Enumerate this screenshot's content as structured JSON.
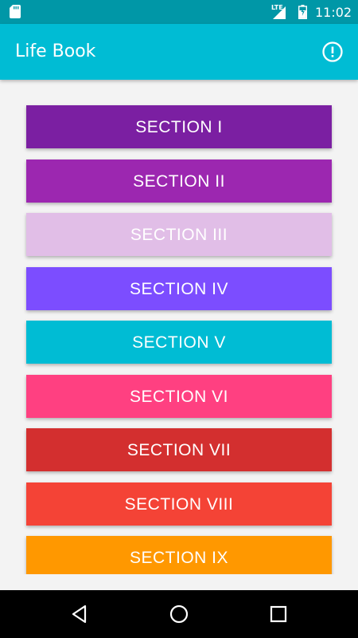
{
  "status_bar": {
    "time": "11:02",
    "network": "LTE",
    "icons": [
      "sd-card-icon",
      "signal-icon",
      "battery-icon"
    ]
  },
  "app_bar": {
    "title": "Life Book",
    "action_icon": "info-icon"
  },
  "sections": [
    {
      "label": "SECTION I",
      "color": "#7b1fa2"
    },
    {
      "label": "SECTION II",
      "color": "#9c27b0"
    },
    {
      "label": "SECTION III",
      "color": "#e1bee7"
    },
    {
      "label": "SECTION IV",
      "color": "#7c4dff"
    },
    {
      "label": "SECTION V",
      "color": "#00bcd4"
    },
    {
      "label": "SECTION VI",
      "color": "#ff4081"
    },
    {
      "label": "SECTION VII",
      "color": "#d32f2f"
    },
    {
      "label": "SECTION VIII",
      "color": "#f44336"
    },
    {
      "label": "SECTION IX",
      "color": "#ff9800"
    }
  ],
  "colors": {
    "status_bar": "#0097a7",
    "app_bar": "#00bcd4",
    "background": "#f3f3f3",
    "nav_bar": "#000000"
  },
  "nav_bar": {
    "icons": [
      "back-icon",
      "home-icon",
      "recents-icon"
    ]
  }
}
